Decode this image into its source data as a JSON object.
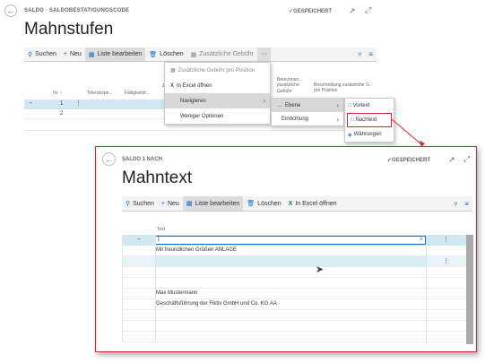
{
  "bg": {
    "breadcrumb": "SALDO · SALDOBESTATIGUNGSCODE",
    "saved": "GESPEICHERT",
    "title": "Mahnstufen",
    "toolbar": {
      "search": "Suchen",
      "new": "Neu",
      "edit_list": "Liste bearbeiten",
      "delete": "Löschen",
      "additional_fee": "Zusätzliche Gebühr",
      "more": "···"
    },
    "columns": {
      "nr": "Nr. ↑",
      "tolerance": "Toleranzpe...",
      "due": "Fälligkeitsf...",
      "zu": "Zu",
      "calc": "Berechnun... zusätzliche Gebühr",
      "desc": "Beschreibung zusätzliche G pro Position"
    },
    "rows": [
      {
        "nr": "1"
      },
      {
        "nr": "2"
      }
    ]
  },
  "menu1": {
    "items": [
      {
        "label": "Zusätzliche Gebühr pro Position"
      },
      {
        "label": "In Excel öffnen"
      },
      {
        "label": "Navigieren"
      },
      {
        "label": "Weniger Optionen"
      }
    ]
  },
  "menu2": {
    "items": [
      {
        "label": "Ebene"
      },
      {
        "label": "Einrichtung"
      }
    ]
  },
  "menu3": {
    "items": [
      {
        "label": "Vortext"
      },
      {
        "label": "Nachtext"
      },
      {
        "label": "Währungen"
      }
    ]
  },
  "fg": {
    "breadcrumb": "SALDO 1 NACH",
    "saved": "GESPEICHERT",
    "title": "Mahntext",
    "toolbar": {
      "search": "Suchen",
      "new": "Neu",
      "edit_list": "Liste bearbeiten",
      "delete": "Löschen",
      "excel": "In Excel öffnen"
    },
    "column": "Text",
    "lines": [
      "",
      "Mit freundlichen Grüßen ANLAGE",
      "",
      "",
      "",
      "Max Mustermann",
      "Geschäftsführung der Fiktiv GmbH und Co. KG AA",
      "",
      "",
      ""
    ]
  },
  "colors": {
    "accent": "#0a6ed1",
    "highlight": "#cfe8f2",
    "annotation": "#d9262c"
  }
}
